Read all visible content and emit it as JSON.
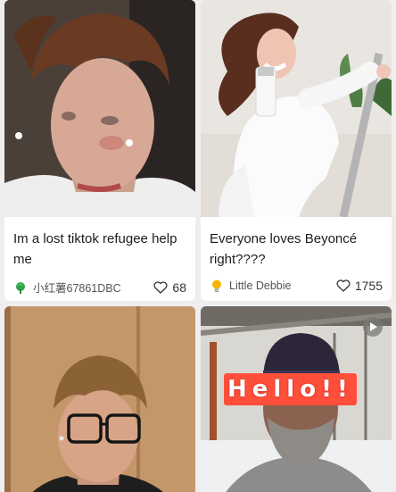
{
  "posts": [
    {
      "title": "Im a lost tiktok refugee help me",
      "author": "小红薯67861DBC",
      "likes": "68",
      "avatar_icon": "leaf-avatar-icon",
      "avatar_color": "#2fa24a"
    },
    {
      "title": "Everyone loves Beyoncé right????",
      "author": "Little Debbie",
      "likes": "1755",
      "avatar_icon": "lightbulb-avatar-icon",
      "avatar_color": "#f5b400"
    },
    {
      "title": "",
      "author": "",
      "likes": ""
    },
    {
      "title": "",
      "author": "",
      "likes": "",
      "overlay_text": "Hello!!"
    }
  ],
  "colors": {
    "background": "#eeeeee",
    "card": "#ffffff",
    "text": "#1d1d1d",
    "meta": "#555555",
    "overlay": "#ff4f3b"
  }
}
